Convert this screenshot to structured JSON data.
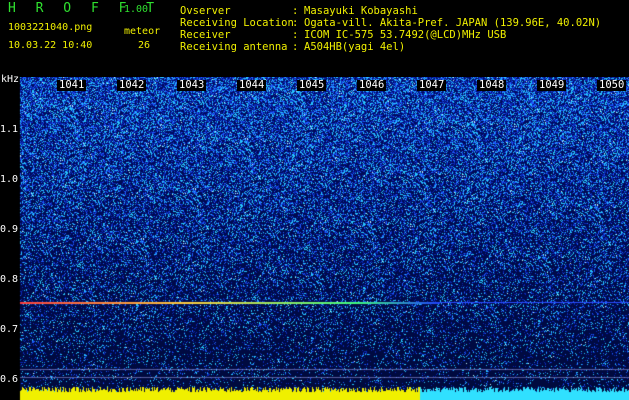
{
  "header": {
    "app_title": "H R O F F T",
    "version": "1.00",
    "filename": "1003221040.png",
    "timestamp": "10.03.22 10:40",
    "meteor_label": "meteor",
    "meteor_count": "26"
  },
  "info": {
    "rows": [
      {
        "label": "Ovserver",
        "value": "Masayuki Kobayashi"
      },
      {
        "label": "Receiving Location",
        "value": "Ogata-vill. Akita-Pref. JAPAN (139.96E, 40.02N)"
      },
      {
        "label": "Receiver",
        "value": "ICOM IC-575 53.7492(@LCD)MHz USB"
      },
      {
        "label": "Receiving antenna",
        "value": "A504HB(yagi 4el)"
      }
    ]
  },
  "spectrogram": {
    "unit_label": "kHz",
    "time_ticks": [
      "1041",
      "1042",
      "1043",
      "1044",
      "1045",
      "1046",
      "1047",
      "1048",
      "1049",
      "1050"
    ],
    "freq_ticks": [
      "1.1",
      "1.0",
      "0.9",
      "0.8",
      "0.7",
      "0.6"
    ],
    "colors": {
      "low": "#001a6e",
      "mid": "#2a5cff",
      "high": "#2fe0ff",
      "peak": "#ffffff",
      "band": "#f0f000"
    }
  }
}
